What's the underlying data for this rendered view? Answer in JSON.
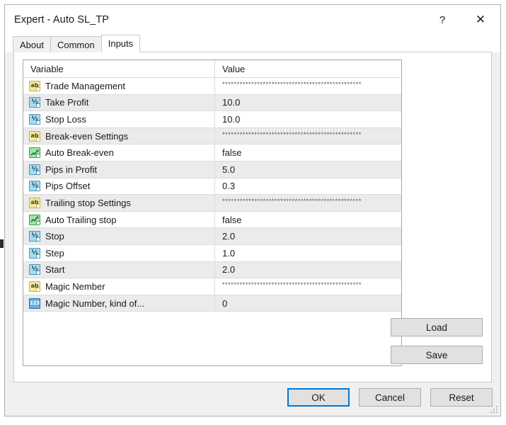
{
  "window": {
    "title": "Expert - Auto SL_TP",
    "help_button": "?",
    "close_button": "✕"
  },
  "tabs": [
    {
      "label": "About",
      "active": false
    },
    {
      "label": "Common",
      "active": false
    },
    {
      "label": "Inputs",
      "active": true
    }
  ],
  "grid": {
    "columns": [
      "Variable",
      "Value"
    ],
    "separator_value": "************************************************",
    "rows": [
      {
        "icon": "string-icon",
        "icon_type": "ab",
        "variable": "Trade Management",
        "value": "************************************************",
        "is_separator": true,
        "shade": "white"
      },
      {
        "icon": "double-icon",
        "icon_type": "half",
        "variable": "Take Profit",
        "value": "10.0",
        "is_separator": false,
        "shade": "alt"
      },
      {
        "icon": "double-icon",
        "icon_type": "half",
        "variable": "Stop Loss",
        "value": "10.0",
        "is_separator": false,
        "shade": "white"
      },
      {
        "icon": "string-icon",
        "icon_type": "ab",
        "variable": "Break-even Settings",
        "value": "************************************************",
        "is_separator": true,
        "shade": "alt"
      },
      {
        "icon": "bool-icon",
        "icon_type": "bool",
        "variable": "Auto Break-even",
        "value": "false",
        "is_separator": false,
        "shade": "white"
      },
      {
        "icon": "double-icon",
        "icon_type": "half",
        "variable": "Pips in Profit",
        "value": "5.0",
        "is_separator": false,
        "shade": "alt"
      },
      {
        "icon": "double-icon",
        "icon_type": "half",
        "variable": "Pips Offset",
        "value": "0.3",
        "is_separator": false,
        "shade": "white"
      },
      {
        "icon": "string-icon",
        "icon_type": "ab",
        "variable": "Trailing stop Settings",
        "value": "************************************************",
        "is_separator": true,
        "shade": "alt"
      },
      {
        "icon": "bool-icon",
        "icon_type": "bool",
        "variable": "Auto Trailing stop",
        "value": "false",
        "is_separator": false,
        "shade": "white"
      },
      {
        "icon": "double-icon",
        "icon_type": "half",
        "variable": "Stop",
        "value": "2.0",
        "is_separator": false,
        "shade": "alt"
      },
      {
        "icon": "double-icon",
        "icon_type": "half",
        "variable": "Step",
        "value": "1.0",
        "is_separator": false,
        "shade": "white"
      },
      {
        "icon": "double-icon",
        "icon_type": "half",
        "variable": "Start",
        "value": "2.0",
        "is_separator": false,
        "shade": "alt"
      },
      {
        "icon": "string-icon",
        "icon_type": "ab",
        "variable": "Magic Nember",
        "value": "************************************************",
        "is_separator": true,
        "shade": "white"
      },
      {
        "icon": "int-icon",
        "icon_type": "int",
        "variable": "Magic Number, kind of...",
        "value": "0",
        "is_separator": false,
        "shade": "alt"
      }
    ]
  },
  "side_buttons": [
    {
      "label": "Load"
    },
    {
      "label": "Save"
    }
  ],
  "footer_buttons": [
    {
      "label": "OK",
      "default": true
    },
    {
      "label": "Cancel",
      "default": false
    },
    {
      "label": "Reset",
      "default": false
    }
  ],
  "colors": {
    "accent": "#0078d7",
    "icon_string": "#f2e9a0",
    "icon_double": "#a8dcf0",
    "icon_bool": "#9ce6a8",
    "icon_int": "#6ab0de",
    "row_alt": "#ebebeb",
    "dialog_bg": "#f0f0f0"
  }
}
